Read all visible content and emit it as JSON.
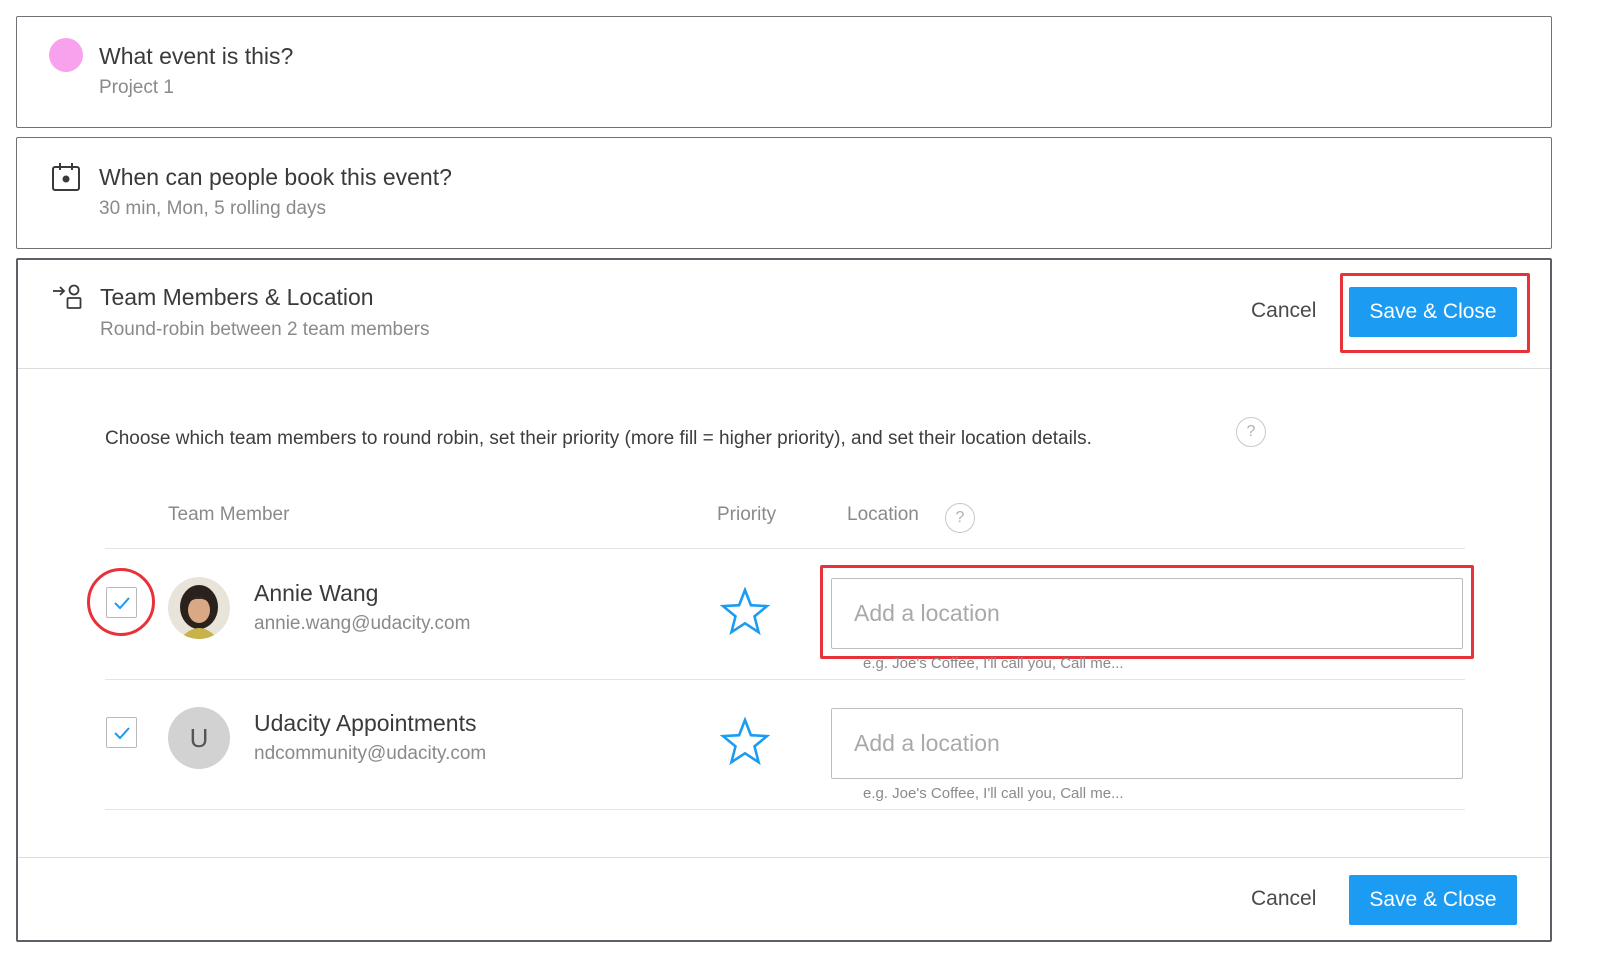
{
  "colors": {
    "accent": "#1b9cf2",
    "event_dot": "#f8a2ed",
    "highlight": "#e8323a",
    "border": "#6f7378"
  },
  "event_section": {
    "title": "What event is this?",
    "subtitle": "Project 1",
    "icon": "pink-dot-icon"
  },
  "booking_section": {
    "title": "When can people book this event?",
    "subtitle": "30 min, Mon, 5 rolling days",
    "icon": "calendar-icon"
  },
  "team_section": {
    "title": "Team Members & Location",
    "subtitle": "Round-robin between 2 team members",
    "icon": "team-assign-icon",
    "cancel_label": "Cancel",
    "save_label": "Save & Close",
    "instructions": "Choose which team members to round robin, set their priority (more fill = higher priority), and set their location details.",
    "help_glyph": "?",
    "columns": {
      "member": "Team Member",
      "priority": "Priority",
      "location": "Location"
    },
    "members": [
      {
        "name": "Annie Wang",
        "email": "annie.wang@udacity.com",
        "checked": true,
        "avatar": "photo",
        "priority_fill": 0,
        "location_value": "",
        "location_placeholder": "Add a location",
        "location_hint": "e.g. Joe's Coffee, I'll call you, Call me..."
      },
      {
        "name": "Udacity Appointments",
        "email": "ndcommunity@udacity.com",
        "checked": true,
        "avatar": "U",
        "priority_fill": 0,
        "location_value": "",
        "location_placeholder": "Add a location",
        "location_hint": "e.g. Joe's Coffee, I'll call you, Call me..."
      }
    ],
    "footer_cancel_label": "Cancel",
    "footer_save_label": "Save & Close"
  }
}
